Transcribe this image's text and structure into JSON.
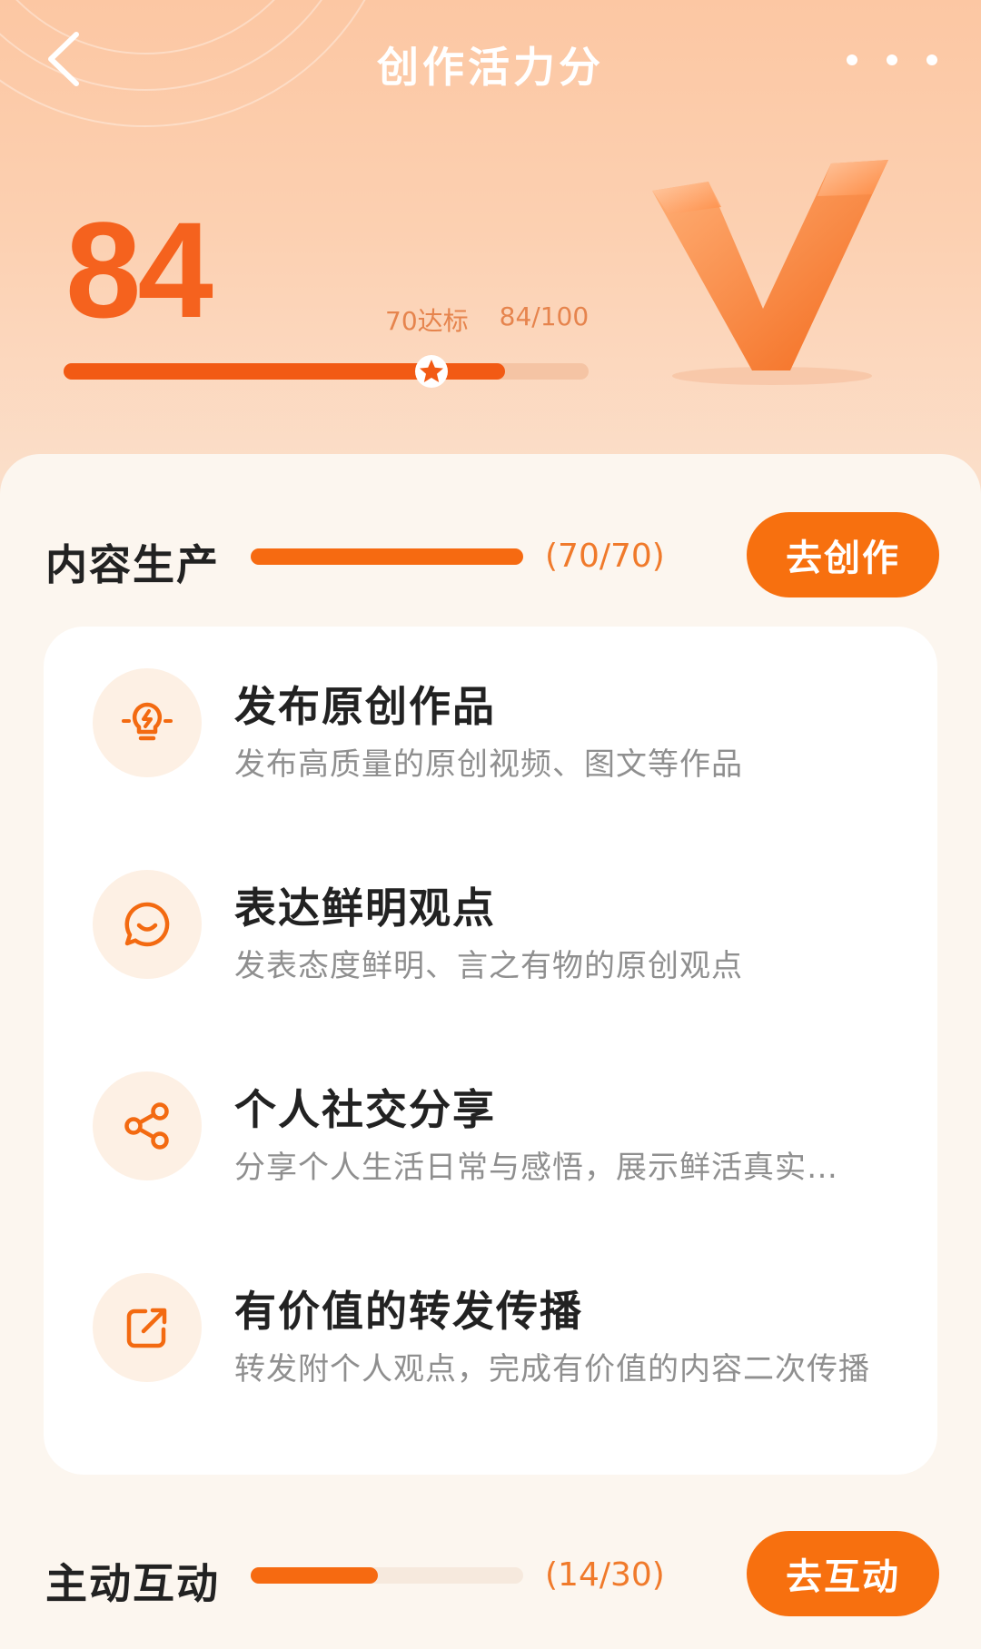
{
  "nav": {
    "title": "创作活力分",
    "back_icon": "chevron-left-icon",
    "more_icon": "more-dots-icon"
  },
  "score": {
    "value": "84",
    "threshold_label": "70达标",
    "progress_label": "84/100",
    "progress_fraction": 0.84,
    "threshold_fraction": 0.7
  },
  "sections": [
    {
      "title": "内容生产",
      "count": "(70/70)",
      "progress_fraction": 1.0,
      "button_label": "去创作"
    },
    {
      "title": "主动互动",
      "count": "(14/30)",
      "progress_fraction": 0.4667,
      "button_label": "去互动"
    }
  ],
  "tasks": [
    {
      "icon": "lightbulb-icon",
      "title": "发布原创作品",
      "desc": "发布高质量的原创视频、图文等作品"
    },
    {
      "icon": "chat-smile-icon",
      "title": "表达鲜明观点",
      "desc": "发表态度鲜明、言之有物的原创观点"
    },
    {
      "icon": "share-icon",
      "title": "个人社交分享",
      "desc": "分享个人生活日常与感悟，展示鲜活真实…"
    },
    {
      "icon": "forward-icon",
      "title": "有价值的转发传播",
      "desc": "转发附个人观点，完成有价值的内容二次传播"
    }
  ],
  "colors": {
    "accent": "#f7700f",
    "score": "#f5621e",
    "progress_track": "#f6e9dd"
  }
}
